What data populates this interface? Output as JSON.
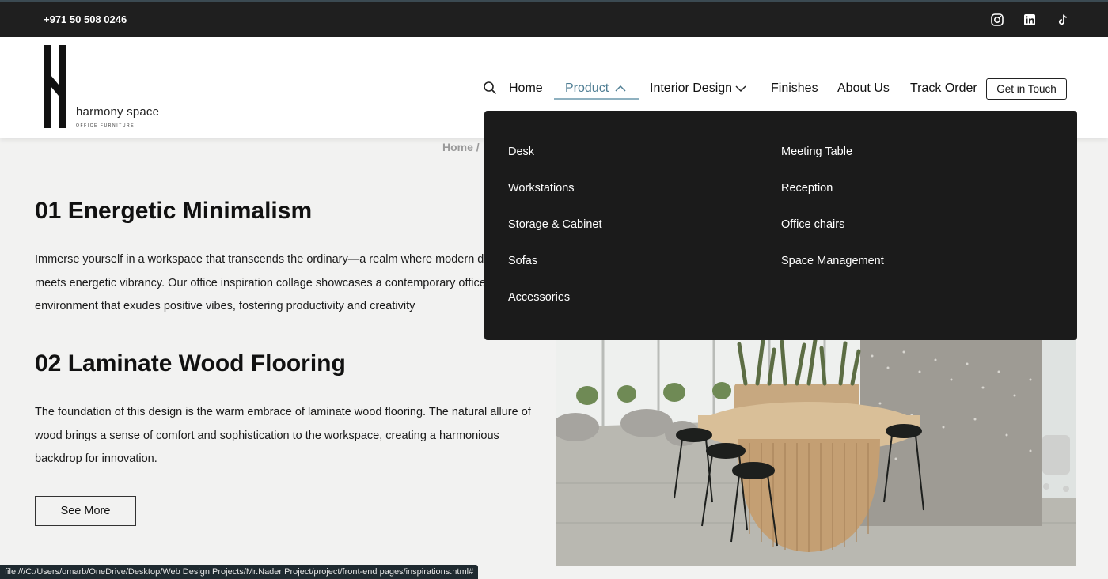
{
  "topbar": {
    "phone": "+971 50 508 0246",
    "social": [
      "instagram-icon",
      "linkedin-icon",
      "tiktok-icon"
    ]
  },
  "header": {
    "logo_name": "harmony space",
    "logo_sub": "OFFICE FURNITURE",
    "nav": {
      "home": "Home",
      "product": "Product",
      "interior": "Interior Design",
      "finishes": "Finishes",
      "about": "About Us",
      "track": "Track Order"
    },
    "cta": "Get in Touch"
  },
  "dropdown": {
    "left": [
      "Desk",
      "Workstations",
      "Storage & Cabinet",
      "Sofas",
      "Accessories"
    ],
    "right": [
      "Meeting Table",
      "Reception",
      "Office chairs",
      "Space Management"
    ]
  },
  "breadcrumb": "Home /",
  "sections": [
    {
      "title": "01 Energetic Minimalism",
      "lines": [
        "Immerse yourself in a workspace that transcends the ordinary—a realm where modern design",
        "meets energetic vibrancy. Our office inspiration collage showcases a contemporary office",
        "environment that exudes positive vibes, fostering productivity and creativity"
      ]
    },
    {
      "title": "02 Laminate Wood Flooring",
      "lines": [
        "The foundation of this design is the warm embrace of laminate wood flooring. The natural allure of",
        "wood brings a sense of comfort and sophistication to the workspace, creating a harmonious",
        "backdrop for innovation."
      ]
    }
  ],
  "see_more": "See More",
  "statusbar": "file:///C:/Users/omarb/OneDrive/Desktop/Web Design Projects/Mr.Nader Project/project/front-end pages/inspirations.html#",
  "colors": {
    "topbar": "#1f1f1f",
    "dropdown": "#1b1b1b",
    "active_nav": "#4e7d93",
    "page_bg": "#f2f2f1"
  }
}
